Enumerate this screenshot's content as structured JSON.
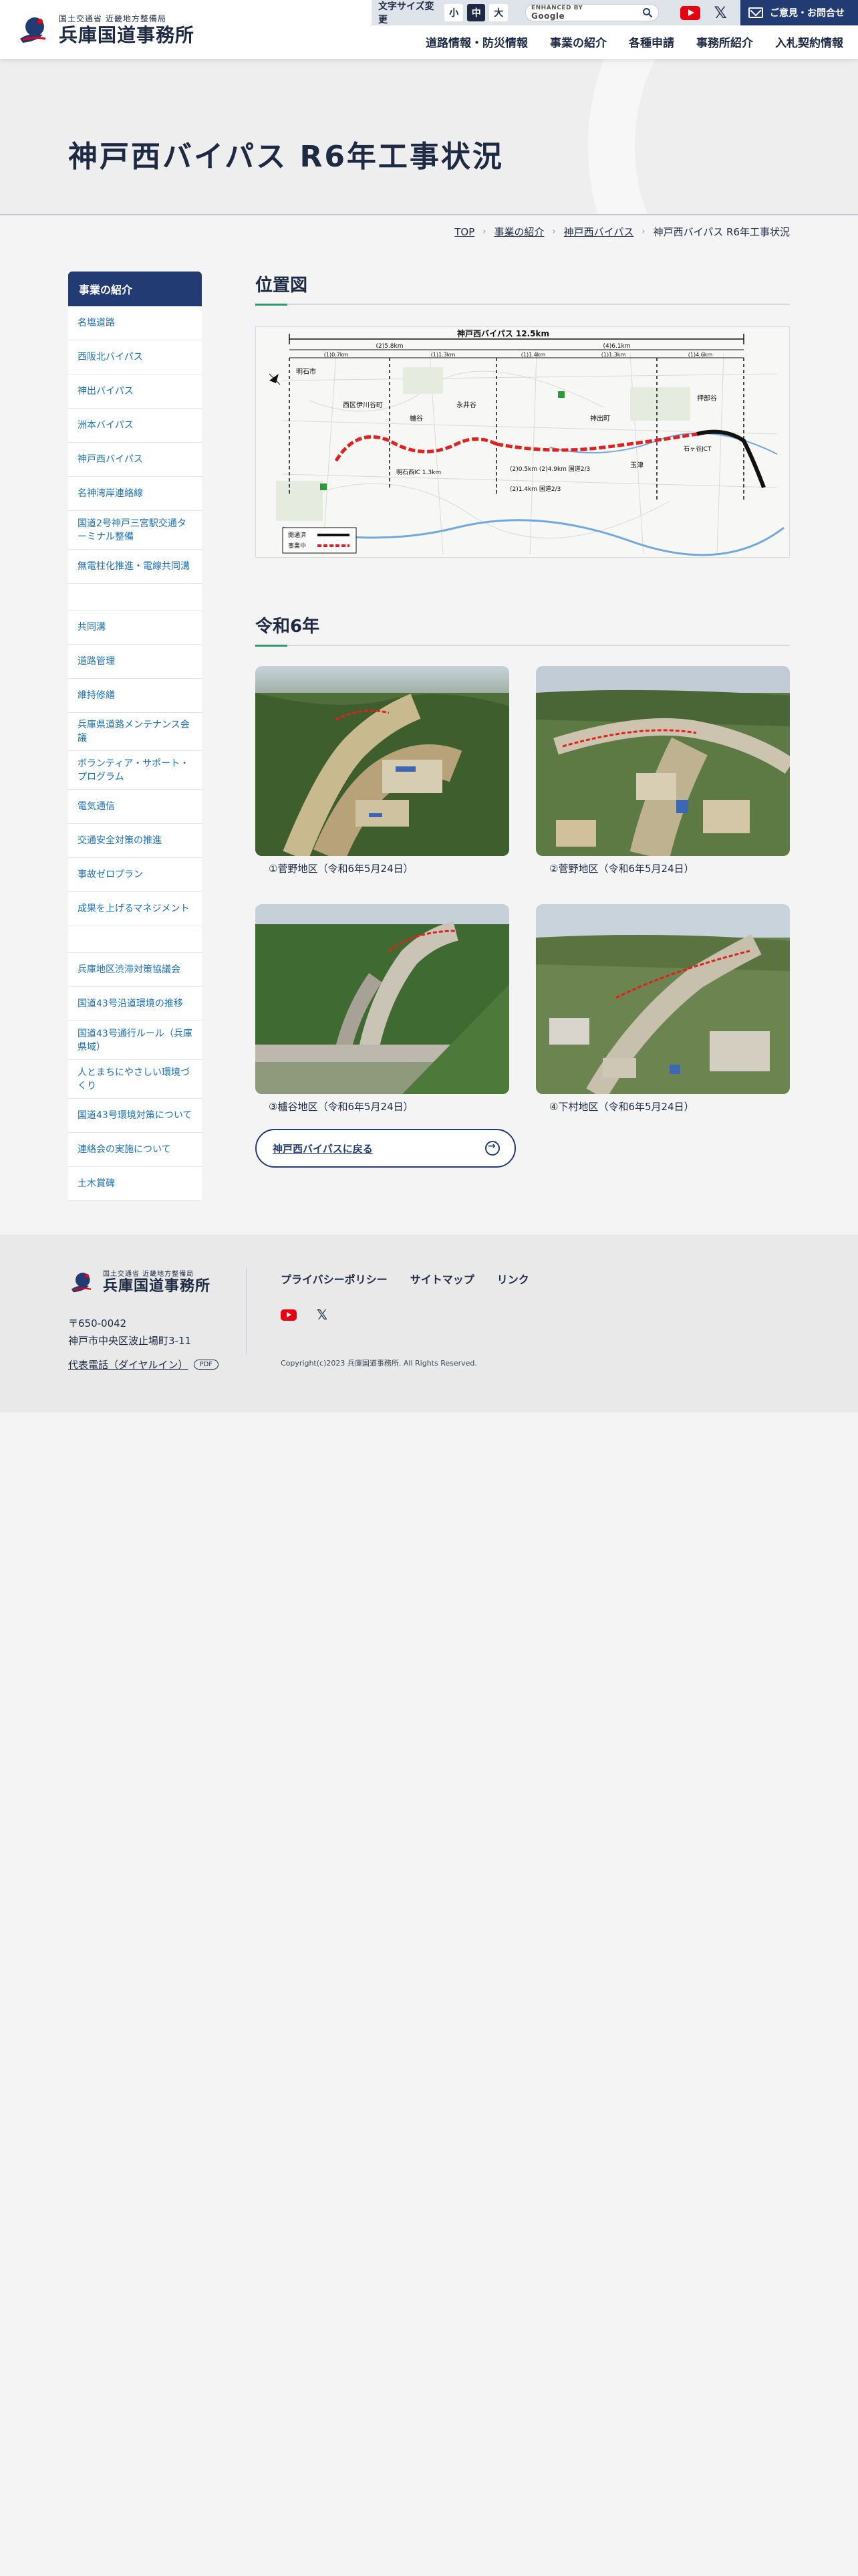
{
  "header": {
    "logo_sub": "国土交通省 近畿地方整備局",
    "logo_main": "兵庫国道事務所",
    "font_size_label": "文字サイズ変更",
    "font_sizes": [
      "小",
      "中",
      "大"
    ],
    "font_size_selected": "中",
    "search_brand_small": "ENHANCED BY",
    "search_brand": "Google",
    "contact_label": "ご意見・お問合せ",
    "nav": [
      "道路情報・防災情報",
      "事業の紹介",
      "各種申請",
      "事務所紹介",
      "入札契約情報"
    ]
  },
  "page_title": "神戸西バイパス R6年工事状況",
  "breadcrumb": [
    "TOP",
    "事業の紹介",
    "神戸西バイパス",
    "神戸西バイパス R6年工事状況"
  ],
  "sidebar": {
    "heading": "事業の紹介",
    "items": [
      "名塩道路",
      "西阪北バイパス",
      "神出バイパス",
      "洲本バイパス",
      "神戸西バイパス",
      "名神湾岸連絡線",
      "国道2号神戸三宮駅交通ターミナル整備",
      "無電柱化推進・電線共同溝",
      "",
      "共同溝",
      "道路管理",
      "維持修繕",
      "兵庫県道路メンテナンス会議",
      "ボランティア・サポート・プログラム",
      "電気通信",
      "交通安全対策の推進",
      "事故ゼロプラン",
      "成果を上げるマネジメント",
      "",
      "兵庫地区渋滞対策協議会",
      "国道43号沿道環境の推移",
      "国道43号通行ルール（兵庫県域）",
      "人とまちにやさしい環境づくり",
      "国道43号環境対策について",
      "連絡会の実施について",
      "土木賞碑"
    ]
  },
  "sections": {
    "location_title": "位置図",
    "year_title": "令和6年"
  },
  "map": {
    "top_label": "神戸西バイパス 12.5km",
    "seg_labels": [
      "(2)5.8km",
      "(4)6.1km",
      "(1)0.7km",
      "(1)1.3km",
      "(1)1.4km",
      "(1)1.3km",
      "(1)4.6km"
    ],
    "legend_open": "開通済",
    "legend_work": "事業中",
    "place_labels": [
      "西区伊川谷町",
      "櫨谷",
      "永井谷",
      "神出町",
      "明石市",
      "玉津",
      "押部谷"
    ],
    "section_labels": [
      "(2)0.5km (2)4.9km 国道2/3",
      "明石西IC 1.3km",
      "石ヶ谷JCT",
      "(2)1.4km 国道2/3"
    ]
  },
  "photos": [
    {
      "caption": "①菅野地区（令和6年5月24日）"
    },
    {
      "caption": "②菅野地区（令和6年5月24日）"
    },
    {
      "caption": "③櫨谷地区（令和6年5月24日）"
    },
    {
      "caption": "④下村地区（令和6年5月24日）"
    }
  ],
  "back_label": "神戸西バイパスに戻る",
  "footer": {
    "postal": "〒650-0042",
    "address": "神戸市中央区波止場町3-11",
    "tel_link": "代表電話（ダイヤルイン）",
    "pdf": "PDF",
    "links": [
      "プライバシーポリシー",
      "サイトマップ",
      "リンク"
    ],
    "copyright": "Copyright(c)2023 兵庫国道事務所. All Rights Reserved."
  },
  "colors": {
    "navy": "#233b73",
    "text": "#1e2a44",
    "link": "#1a6fb8",
    "accent_green": "#2a9d6e",
    "youtube_red": "#e60012"
  }
}
